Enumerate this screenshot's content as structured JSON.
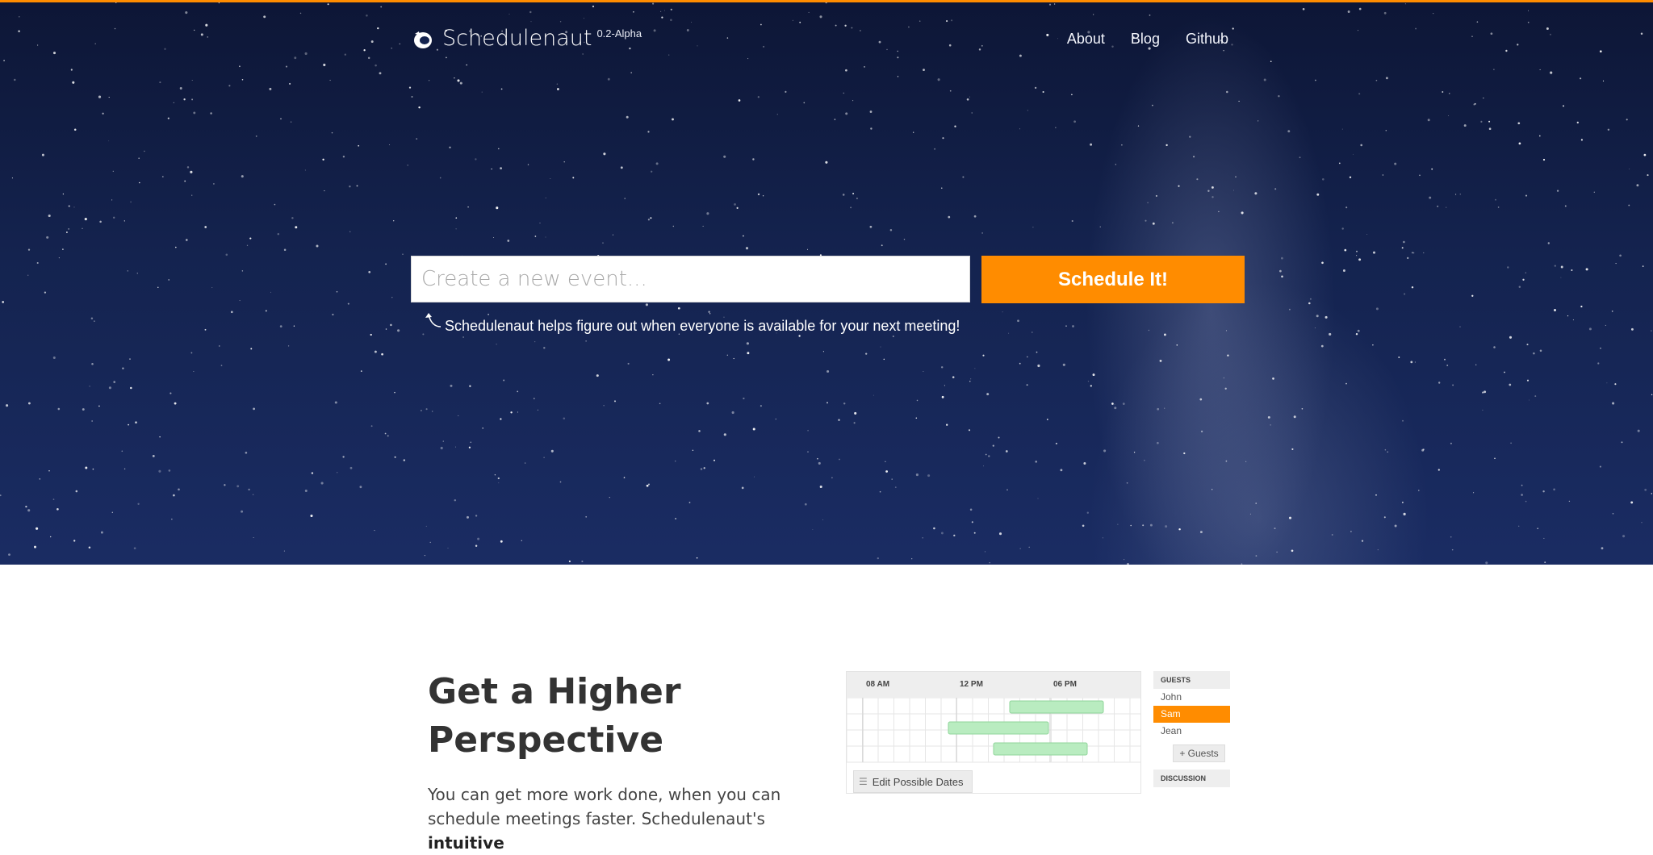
{
  "brand": {
    "name": "Schedulenaut",
    "version": "0.2-Alpha"
  },
  "nav": {
    "about": "About",
    "blog": "Blog",
    "github": "Github"
  },
  "hero": {
    "input_placeholder": "Create a new event...",
    "button_label": "Schedule It!",
    "hint": "Schedulenaut helps figure out when everyone is available for your next meeting!"
  },
  "feature": {
    "headline_line1": "Get a Higher",
    "headline_line2": "Perspective",
    "body_start": "You can get more work done, when you can schedule meetings faster. Schedulenaut's",
    "body_bold": "intuitive"
  },
  "preview": {
    "times": [
      "08 AM",
      "12 PM",
      "06 PM"
    ],
    "edit_button": "Edit Possible Dates",
    "guests_header": "GUESTS",
    "guests": [
      "John",
      "Sam",
      "Jean"
    ],
    "add_guests": "+ Guests",
    "discussion_header": "DISCUSSION"
  },
  "colors": {
    "accent": "#ff8c00",
    "sky_dark": "#0d1636",
    "sky_light": "#1a2c63",
    "availability": "#b9ecc0"
  },
  "icons": {
    "logo": "astronaut-helmet-icon",
    "hint": "curved-arrow-icon",
    "edit": "list-icon"
  }
}
